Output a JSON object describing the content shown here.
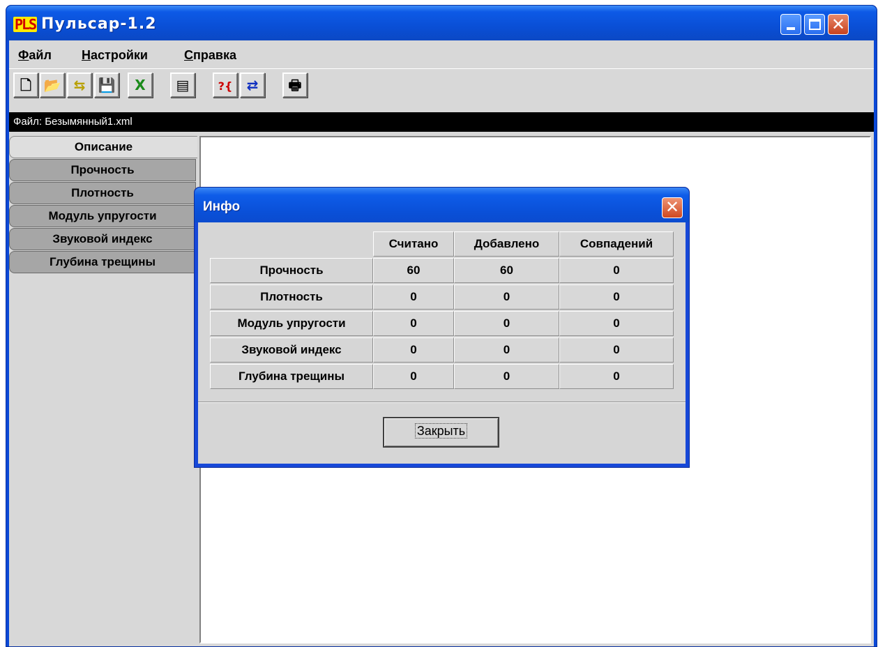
{
  "window": {
    "logo": "PLS",
    "title": "Пульсар-1.2"
  },
  "menu": {
    "file": {
      "accel": "Ф",
      "rest": "айл"
    },
    "settings": {
      "accel": "Н",
      "rest": "астройки"
    },
    "help": {
      "accel": "С",
      "rest": "правка"
    }
  },
  "toolbar": {
    "tools": [
      {
        "name": "new-file-icon",
        "glyph": "🗋"
      },
      {
        "name": "open-folder-icon",
        "glyph": "📂"
      },
      {
        "name": "transfer-icon",
        "glyph": "⇆"
      },
      {
        "name": "save-icon",
        "glyph": "💾"
      },
      {
        "name": "excel-export-icon",
        "glyph": "X"
      },
      {
        "name": "device-icon",
        "glyph": "▤"
      },
      {
        "name": "help-query-icon",
        "glyph": "?{"
      },
      {
        "name": "compare-icon",
        "glyph": "⇄"
      },
      {
        "name": "print-icon",
        "glyph": "🖶"
      }
    ]
  },
  "filebar": {
    "text": "Файл: Безымянный1.xml"
  },
  "tabs": [
    "Описание",
    "Прочность",
    "Плотность",
    "Модуль упругости",
    "Звуковой индекс",
    "Глубина трещины"
  ],
  "dialog": {
    "title": "Инфо",
    "columns": [
      "Считано",
      "Добавлено",
      "Совпадений"
    ],
    "rows": [
      {
        "label": "Прочность",
        "values": [
          "60",
          "60",
          "0"
        ]
      },
      {
        "label": "Плотность",
        "values": [
          "0",
          "0",
          "0"
        ]
      },
      {
        "label": "Модуль упругости",
        "values": [
          "0",
          "0",
          "0"
        ]
      },
      {
        "label": "Звуковой индекс",
        "values": [
          "0",
          "0",
          "0"
        ]
      },
      {
        "label": "Глубина трещины",
        "values": [
          "0",
          "0",
          "0"
        ]
      }
    ],
    "close_label": "Закрыть"
  }
}
